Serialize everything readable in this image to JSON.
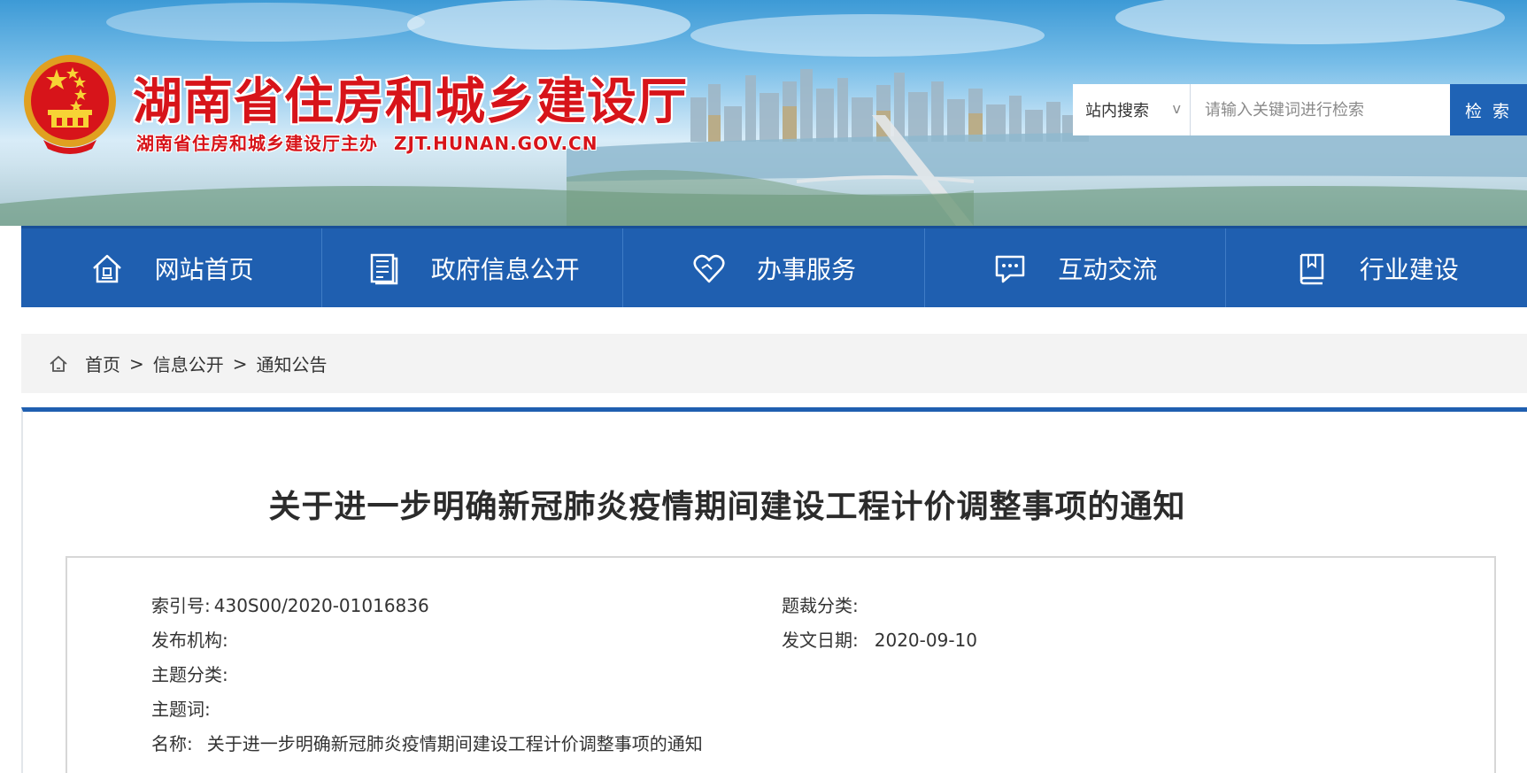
{
  "header": {
    "site_title": "湖南省住房和城乡建设厅",
    "site_subtitle": "湖南省住房和城乡建设厅主办",
    "site_domain": "ZJT.HUNAN.GOV.CN"
  },
  "search": {
    "scope": "站内搜索",
    "scope_chevron": "v",
    "placeholder": "请输入关键词进行检索",
    "button": "检 索"
  },
  "nav": {
    "items": [
      {
        "label": "网站首页",
        "icon": "home-icon"
      },
      {
        "label": "政府信息公开",
        "icon": "document-icon"
      },
      {
        "label": "办事服务",
        "icon": "heart-icon"
      },
      {
        "label": "互动交流",
        "icon": "chat-icon"
      },
      {
        "label": "行业建设",
        "icon": "book-icon"
      }
    ]
  },
  "breadcrumb": {
    "icon": "home-icon",
    "items": [
      "首页",
      "信息公开",
      "通知公告"
    ],
    "separator": ">"
  },
  "article": {
    "title": "关于进一步明确新冠肺炎疫情期间建设工程计价调整事项的通知",
    "meta": {
      "index_label": "索引号:",
      "index_value": "430S00/2020-01016836",
      "genre_label": "题裁分类:",
      "genre_value": "",
      "issuer_label": "发布机构:",
      "issuer_value": "",
      "date_label": "发文日期:",
      "date_value": "2020-09-10",
      "topic_label": "主题分类:",
      "topic_value": "",
      "keywords_label": "主题词:",
      "keywords_value": "",
      "name_label": "名称:",
      "name_value": "关于进一步明确新冠肺炎疫情期间建设工程计价调整事项的通知"
    }
  },
  "colors": {
    "brand_red": "#d7141a",
    "nav_blue": "#1f5fb0",
    "search_button": "#1f63b5"
  }
}
